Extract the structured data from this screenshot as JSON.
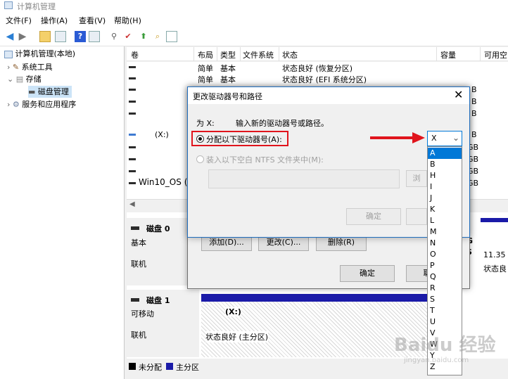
{
  "window": {
    "title": "计算机管理"
  },
  "menu": [
    "文件(F)",
    "操作(A)",
    "查看(V)",
    "帮助(H)"
  ],
  "tree": {
    "root": "计算机管理(本地)",
    "items": [
      {
        "label": "系统工具"
      },
      {
        "label": "存储"
      },
      {
        "label": "磁盘管理"
      },
      {
        "label": "服务和应用程序"
      }
    ]
  },
  "volume_table": {
    "columns": [
      "卷",
      "布局",
      "类型",
      "文件系统",
      "状态",
      "容量",
      "可用空"
    ],
    "rows": [
      {
        "vol": "",
        "layout": "简单",
        "type": "基本",
        "fs": "",
        "status": "状态良好 (恢复分区)"
      },
      {
        "vol": "",
        "layout": "简单",
        "type": "基本",
        "fs": "",
        "status": "状态良好 (EFI 系统分区)"
      },
      {
        "vol": "",
        "size_tail": "B"
      },
      {
        "vol": "",
        "size_tail": "B"
      },
      {
        "vol": "",
        "size_tail": "B"
      },
      {
        "vol": "(X:)",
        "size_tail": "B"
      },
      {
        "vol": "",
        "size_tail": "GB"
      },
      {
        "vol": "",
        "size_tail": "GB"
      },
      {
        "vol": "",
        "size_tail": "GB"
      },
      {
        "vol": "Win10_OS (C",
        "size_tail": "GB"
      }
    ]
  },
  "disks": [
    {
      "name": "磁盘 0",
      "kind": "基本",
      "state": "联机",
      "right_capacity": "11.35",
      "right_status": "状态良",
      "right_g": "G",
      "right_s": "S"
    },
    {
      "name": "磁盘 1",
      "kind": "可移动",
      "state": "联机",
      "part_label": "(X:)",
      "part_status": "状态良好 (主分区)"
    }
  ],
  "legend": [
    {
      "label": "未分配",
      "color": "#000000"
    },
    {
      "label": "主分区",
      "color": "#1a1aa8"
    }
  ],
  "back_dialog": {
    "add": "添加(D)...",
    "change": "更改(C)...",
    "delete": "删除(R)",
    "ok": "确定",
    "cancel_partial": "取"
  },
  "dialog": {
    "title": "更改驱动器号和路径",
    "for_label": "为 X:",
    "instruction": "输入新的驱动器号或路径。",
    "option_assign": "分配以下驱动器号(A):",
    "option_mount": "装入以下空白 NTFS 文件夹中(M):",
    "browse_partial": "浏",
    "ok": "确定",
    "selected_letter": "X",
    "letters": [
      "A",
      "B",
      "H",
      "I",
      "J",
      "K",
      "L",
      "M",
      "N",
      "O",
      "P",
      "Q",
      "R",
      "S",
      "T",
      "U",
      "V",
      "W",
      "Y",
      "Z"
    ],
    "highlighted_letter": "A"
  },
  "colors": {
    "accent": "#0078d7",
    "highlight_box": "#e0141c",
    "primary_partition": "#1a1aa8"
  },
  "watermark": {
    "text": "Baidu 经验",
    "sub": "jingyan.baidu.com"
  }
}
